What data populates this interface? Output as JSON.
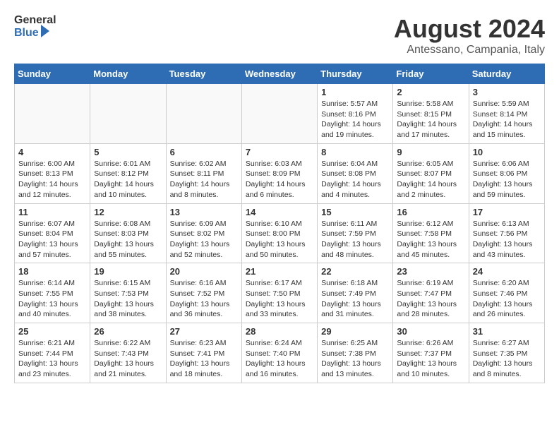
{
  "header": {
    "logo_general": "General",
    "logo_blue": "Blue",
    "title": "August 2024",
    "subtitle": "Antessano, Campania, Italy"
  },
  "days_of_week": [
    "Sunday",
    "Monday",
    "Tuesday",
    "Wednesday",
    "Thursday",
    "Friday",
    "Saturday"
  ],
  "weeks": [
    [
      {
        "day": "",
        "info": ""
      },
      {
        "day": "",
        "info": ""
      },
      {
        "day": "",
        "info": ""
      },
      {
        "day": "",
        "info": ""
      },
      {
        "day": "1",
        "info": "Sunrise: 5:57 AM\nSunset: 8:16 PM\nDaylight: 14 hours\nand 19 minutes."
      },
      {
        "day": "2",
        "info": "Sunrise: 5:58 AM\nSunset: 8:15 PM\nDaylight: 14 hours\nand 17 minutes."
      },
      {
        "day": "3",
        "info": "Sunrise: 5:59 AM\nSunset: 8:14 PM\nDaylight: 14 hours\nand 15 minutes."
      }
    ],
    [
      {
        "day": "4",
        "info": "Sunrise: 6:00 AM\nSunset: 8:13 PM\nDaylight: 14 hours\nand 12 minutes."
      },
      {
        "day": "5",
        "info": "Sunrise: 6:01 AM\nSunset: 8:12 PM\nDaylight: 14 hours\nand 10 minutes."
      },
      {
        "day": "6",
        "info": "Sunrise: 6:02 AM\nSunset: 8:11 PM\nDaylight: 14 hours\nand 8 minutes."
      },
      {
        "day": "7",
        "info": "Sunrise: 6:03 AM\nSunset: 8:09 PM\nDaylight: 14 hours\nand 6 minutes."
      },
      {
        "day": "8",
        "info": "Sunrise: 6:04 AM\nSunset: 8:08 PM\nDaylight: 14 hours\nand 4 minutes."
      },
      {
        "day": "9",
        "info": "Sunrise: 6:05 AM\nSunset: 8:07 PM\nDaylight: 14 hours\nand 2 minutes."
      },
      {
        "day": "10",
        "info": "Sunrise: 6:06 AM\nSunset: 8:06 PM\nDaylight: 13 hours\nand 59 minutes."
      }
    ],
    [
      {
        "day": "11",
        "info": "Sunrise: 6:07 AM\nSunset: 8:04 PM\nDaylight: 13 hours\nand 57 minutes."
      },
      {
        "day": "12",
        "info": "Sunrise: 6:08 AM\nSunset: 8:03 PM\nDaylight: 13 hours\nand 55 minutes."
      },
      {
        "day": "13",
        "info": "Sunrise: 6:09 AM\nSunset: 8:02 PM\nDaylight: 13 hours\nand 52 minutes."
      },
      {
        "day": "14",
        "info": "Sunrise: 6:10 AM\nSunset: 8:00 PM\nDaylight: 13 hours\nand 50 minutes."
      },
      {
        "day": "15",
        "info": "Sunrise: 6:11 AM\nSunset: 7:59 PM\nDaylight: 13 hours\nand 48 minutes."
      },
      {
        "day": "16",
        "info": "Sunrise: 6:12 AM\nSunset: 7:58 PM\nDaylight: 13 hours\nand 45 minutes."
      },
      {
        "day": "17",
        "info": "Sunrise: 6:13 AM\nSunset: 7:56 PM\nDaylight: 13 hours\nand 43 minutes."
      }
    ],
    [
      {
        "day": "18",
        "info": "Sunrise: 6:14 AM\nSunset: 7:55 PM\nDaylight: 13 hours\nand 40 minutes."
      },
      {
        "day": "19",
        "info": "Sunrise: 6:15 AM\nSunset: 7:53 PM\nDaylight: 13 hours\nand 38 minutes."
      },
      {
        "day": "20",
        "info": "Sunrise: 6:16 AM\nSunset: 7:52 PM\nDaylight: 13 hours\nand 36 minutes."
      },
      {
        "day": "21",
        "info": "Sunrise: 6:17 AM\nSunset: 7:50 PM\nDaylight: 13 hours\nand 33 minutes."
      },
      {
        "day": "22",
        "info": "Sunrise: 6:18 AM\nSunset: 7:49 PM\nDaylight: 13 hours\nand 31 minutes."
      },
      {
        "day": "23",
        "info": "Sunrise: 6:19 AM\nSunset: 7:47 PM\nDaylight: 13 hours\nand 28 minutes."
      },
      {
        "day": "24",
        "info": "Sunrise: 6:20 AM\nSunset: 7:46 PM\nDaylight: 13 hours\nand 26 minutes."
      }
    ],
    [
      {
        "day": "25",
        "info": "Sunrise: 6:21 AM\nSunset: 7:44 PM\nDaylight: 13 hours\nand 23 minutes."
      },
      {
        "day": "26",
        "info": "Sunrise: 6:22 AM\nSunset: 7:43 PM\nDaylight: 13 hours\nand 21 minutes."
      },
      {
        "day": "27",
        "info": "Sunrise: 6:23 AM\nSunset: 7:41 PM\nDaylight: 13 hours\nand 18 minutes."
      },
      {
        "day": "28",
        "info": "Sunrise: 6:24 AM\nSunset: 7:40 PM\nDaylight: 13 hours\nand 16 minutes."
      },
      {
        "day": "29",
        "info": "Sunrise: 6:25 AM\nSunset: 7:38 PM\nDaylight: 13 hours\nand 13 minutes."
      },
      {
        "day": "30",
        "info": "Sunrise: 6:26 AM\nSunset: 7:37 PM\nDaylight: 13 hours\nand 10 minutes."
      },
      {
        "day": "31",
        "info": "Sunrise: 6:27 AM\nSunset: 7:35 PM\nDaylight: 13 hours\nand 8 minutes."
      }
    ]
  ]
}
